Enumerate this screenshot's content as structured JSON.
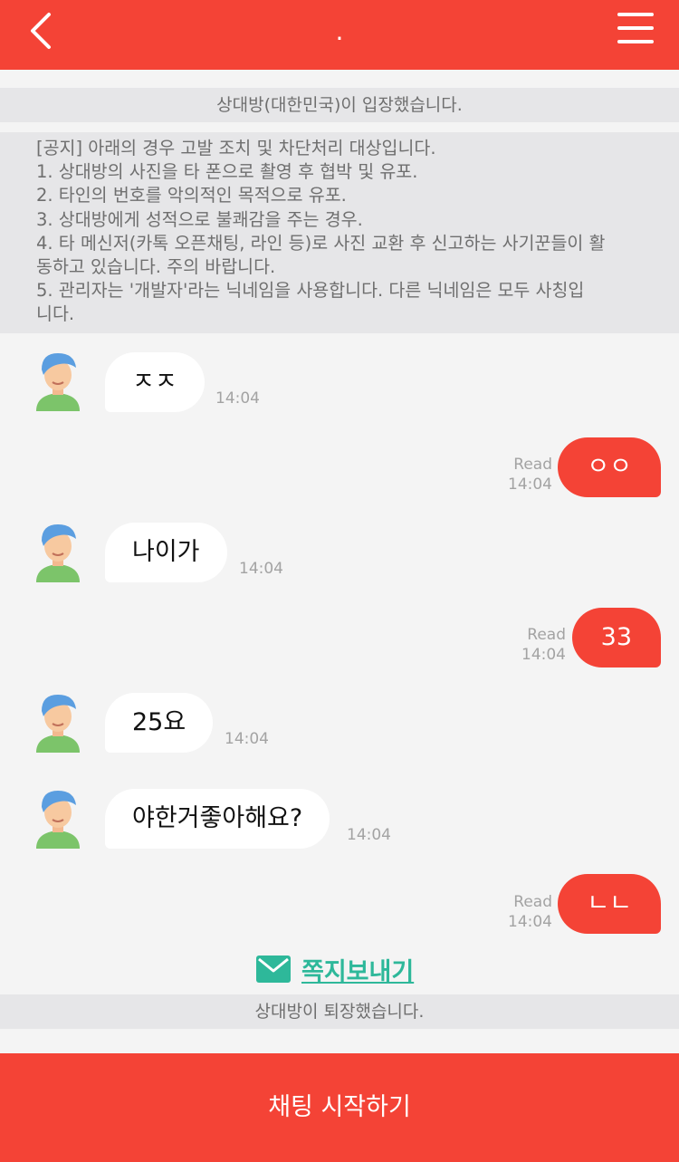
{
  "header": {
    "title": "."
  },
  "system": {
    "entered": "상대방(대한민국)이 입장했습니다.",
    "left": "상대방이 퇴장했습니다."
  },
  "notice": {
    "lines": [
      "[공지] 아래의 경우 고발 조치 및 차단처리 대상입니다.",
      "1. 상대방의 사진을 타 폰으로 촬영 후 협박 및 유포.",
      "2. 타인의 번호를 악의적인 목적으로 유포.",
      "3. 상대방에게 성적으로 불쾌감을 주는 경우.",
      "4. 타 메신저(카톡 오픈채팅, 라인 등)로 사진 교환 후 신고하는 사기꾼들이 활",
      "동하고 있습니다. 주의 바랍니다.",
      "5. 관리자는 '개발자'라는 닉네임을 사용합니다. 다른 닉네임은 모두 사칭입",
      "니다."
    ]
  },
  "messages": [
    {
      "dir": "in",
      "text": "ㅈㅈ",
      "time": "14:04"
    },
    {
      "dir": "out",
      "text": "ㅇㅇ",
      "time": "14:04",
      "read": "Read"
    },
    {
      "dir": "in",
      "text": "나이가",
      "time": "14:04"
    },
    {
      "dir": "out",
      "text": "33",
      "time": "14:04",
      "read": "Read"
    },
    {
      "dir": "in",
      "text": "25요",
      "time": "14:04"
    },
    {
      "dir": "in",
      "text": "야한거좋아해요?",
      "time": "14:04"
    },
    {
      "dir": "out",
      "text": "ㄴㄴ",
      "time": "14:04",
      "read": "Read"
    }
  ],
  "note_link": {
    "label": "쪽지보내기",
    "icon": "envelope-icon"
  },
  "footer": {
    "start_label": "채팅 시작하기"
  },
  "colors": {
    "accent": "#f44336",
    "link": "#2eb89a",
    "system_bg": "#e6e6e8"
  }
}
